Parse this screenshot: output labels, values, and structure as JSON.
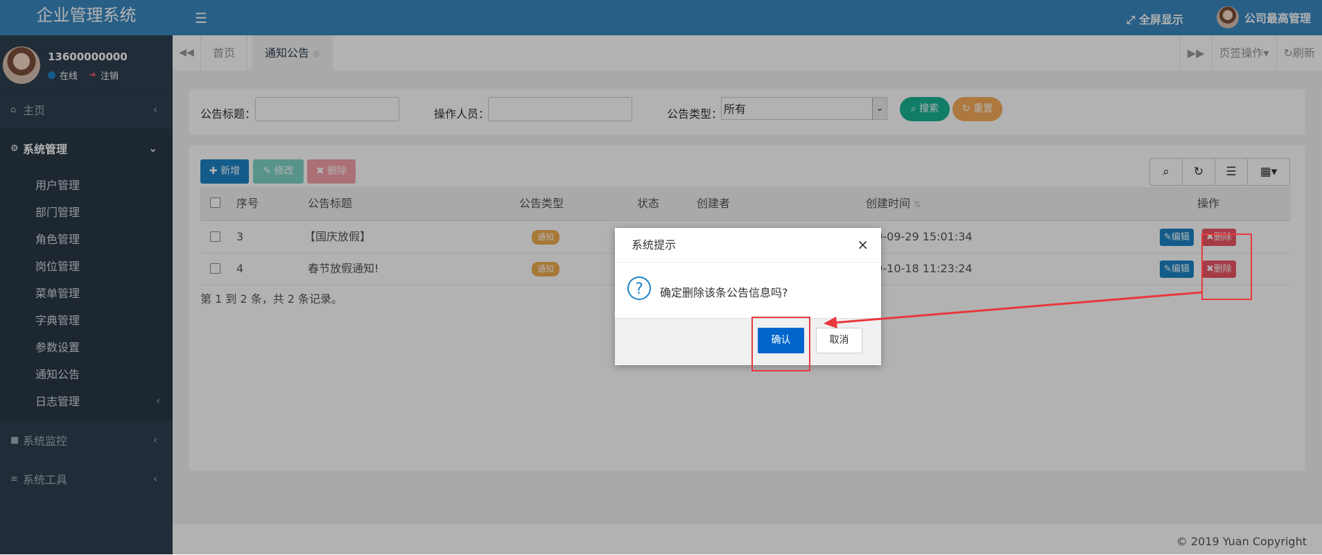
{
  "app": {
    "title": "企业管理系统"
  },
  "sidebar": {
    "user_name": "13600000000",
    "status_online": "在线",
    "status_logout": "注销",
    "menu": [
      {
        "label": "主页",
        "icon": "home-icon"
      },
      {
        "label": "系统管理",
        "icon": "gear-icon"
      },
      {
        "label": "系统监控",
        "icon": "video-icon"
      },
      {
        "label": "系统工具",
        "icon": "bars-icon"
      }
    ],
    "submenu": [
      "用户管理",
      "部门管理",
      "角色管理",
      "岗位管理",
      "菜单管理",
      "字典管理",
      "参数设置",
      "通知公告",
      "日志管理"
    ]
  },
  "header": {
    "fullscreen_label": "全屏显示",
    "admin_name": "公司最高管理"
  },
  "tabs": {
    "home": "首页",
    "active": "通知公告",
    "page_ops": "页签操作",
    "refresh": "刷新"
  },
  "filters": {
    "title_label": "公告标题：",
    "operator_label": "操作人员：",
    "type_label": "公告类型：",
    "type_value": "所有",
    "search_label": "搜索",
    "reset_label": "重置"
  },
  "toolbar": {
    "add_label": "新增",
    "edit_label": "修改",
    "delete_label": "删除"
  },
  "table": {
    "columns": [
      "序号",
      "公告标题",
      "公告类型",
      "状态",
      "创建者",
      "创建时间",
      "操作"
    ],
    "rows": [
      {
        "id": "3",
        "title": "【国庆放假】",
        "type": "通知",
        "created": "19-09-29 15:01:34"
      },
      {
        "id": "4",
        "title": "春节放假通知!",
        "type": "通知",
        "created": "19-10-18 11:23:24"
      }
    ],
    "row_edit": "编辑",
    "row_delete": "删除",
    "pager_text": "第 1 到 2 条，共 2 条记录。"
  },
  "dialog": {
    "title": "系统提示",
    "message": "确定删除该条公告信息吗?",
    "confirm_label": "确认",
    "cancel_label": "取消"
  },
  "footer": {
    "copyright": "© 2019 Yuan Copyright"
  },
  "colors": {
    "header": "#3a89c1",
    "sidebar": "#2f4050",
    "primary": "#1c84c6",
    "danger": "#ed5565",
    "success": "#1ab394",
    "warning": "#f8ac59",
    "annotation": "#e8383d"
  }
}
